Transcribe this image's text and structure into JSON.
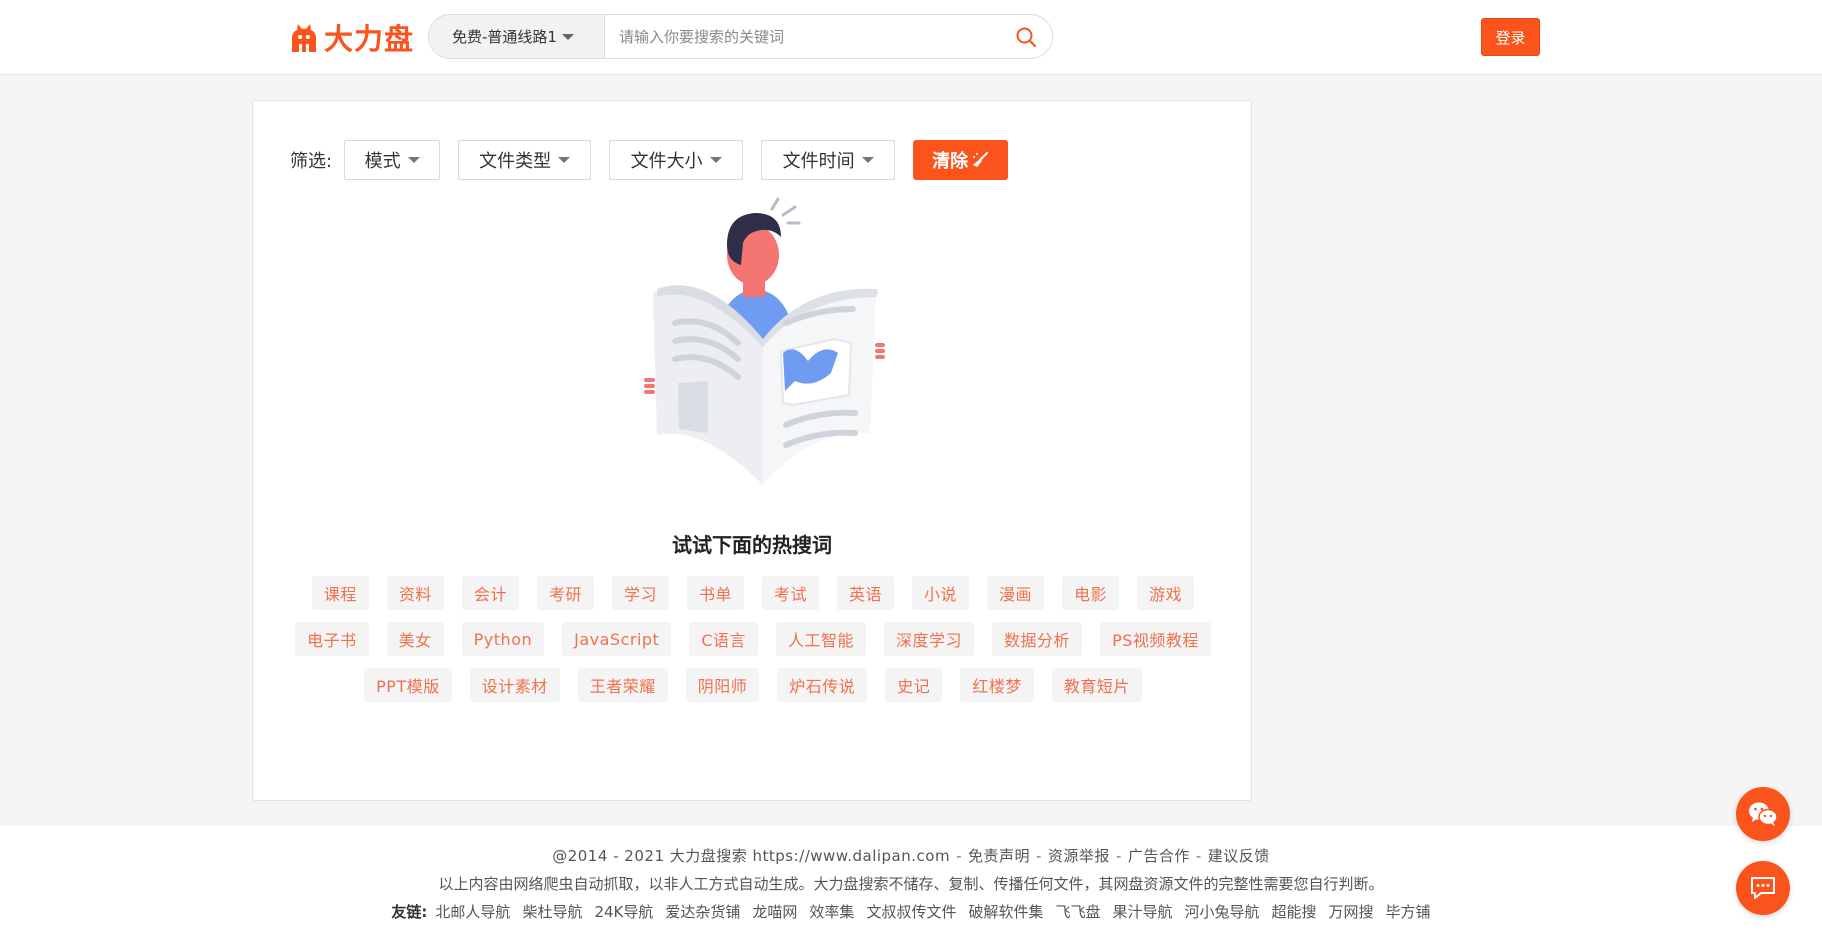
{
  "header": {
    "logo_text": "大力盘",
    "route_select": "免费-普通线路1",
    "search_placeholder": "请输入你要搜索的关键词",
    "login_label": "登录"
  },
  "filters": {
    "label": "筛选:",
    "buttons": [
      "模式",
      "文件类型",
      "文件大小",
      "文件时间"
    ],
    "clear_label": "清除"
  },
  "hot": {
    "title": "试试下面的热搜词",
    "tags": [
      "课程",
      "资料",
      "会计",
      "考研",
      "学习",
      "书单",
      "考试",
      "英语",
      "小说",
      "漫画",
      "电影",
      "游戏",
      "电子书",
      "美女",
      "Python",
      "JavaScript",
      "C语言",
      "人工智能",
      "深度学习",
      "数据分析",
      "PS视频教程",
      "PPT模版",
      "设计素材",
      "王者荣耀",
      "阴阳师",
      "炉石传说",
      "史记",
      "红楼梦",
      "教育短片"
    ]
  },
  "footer": {
    "copyright": "@2014 - 2021 大力盘搜索 https://www.dalipan.com",
    "links": [
      "免责声明",
      "资源举报",
      "广告合作",
      "建议反馈"
    ],
    "disclaimer": "以上内容由网络爬虫自动抓取，以非人工方式自动生成。大力盘搜索不储存、复制、传播任何文件，其网盘资源文件的完整性需要您自行判断。",
    "friends_label": "友链:",
    "friends": [
      "北邮人导航",
      "柴杜导航",
      "24K导航",
      "爱达杂货铺",
      "龙喵网",
      "效率集",
      "文叔叔传文件",
      "破解软件集",
      "飞飞盘",
      "果汁导航",
      "河小兔导航",
      "超能搜",
      "万网搜",
      "毕方铺"
    ]
  },
  "colors": {
    "accent": "#fa541c",
    "tag_text": "#f07150"
  },
  "icons": {
    "search": "search-icon",
    "wechat": "wechat-icon",
    "feedback": "message-icon"
  }
}
